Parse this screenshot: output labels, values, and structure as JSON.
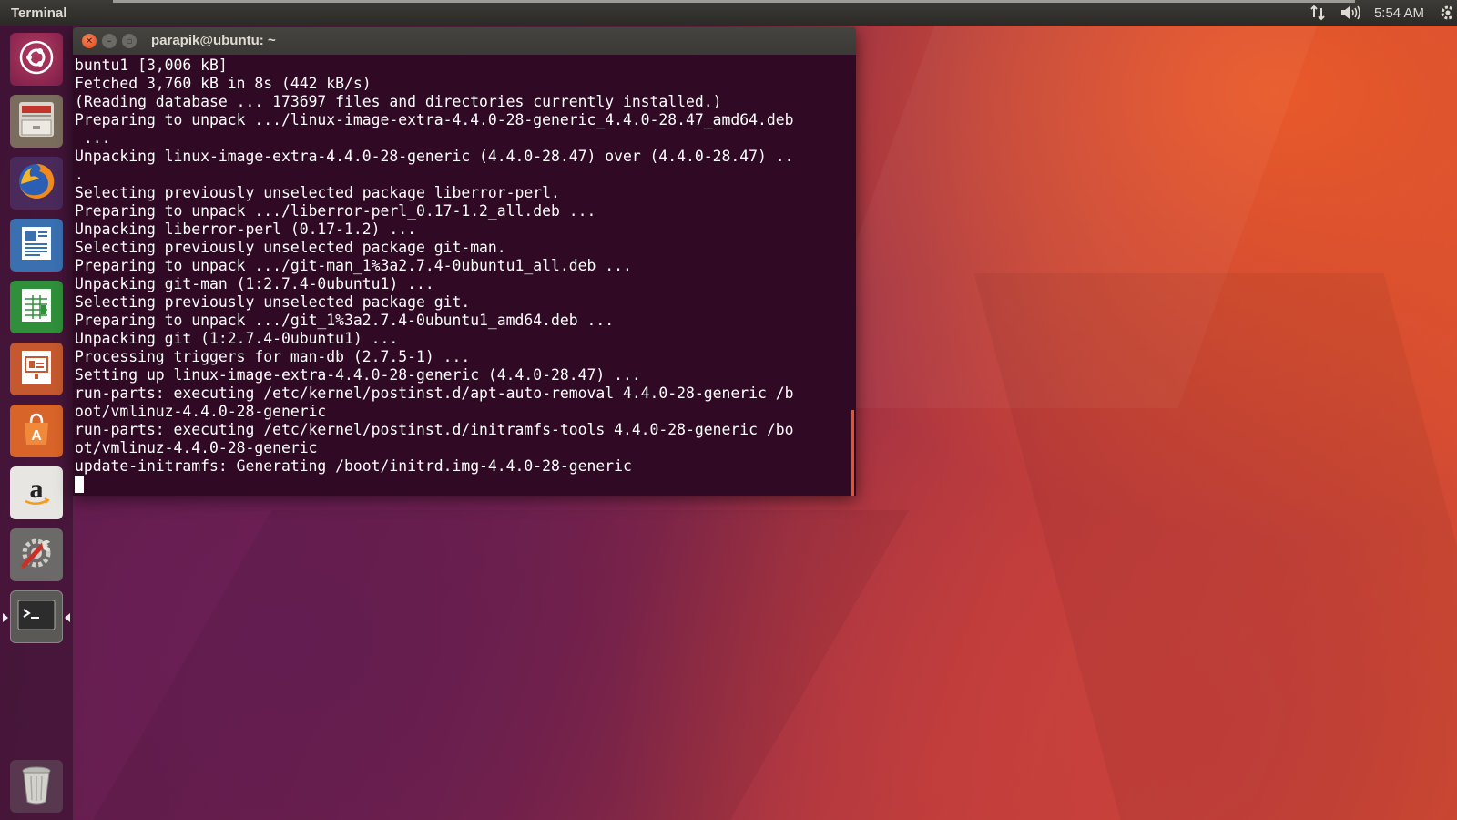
{
  "top_panel": {
    "app_title": "Terminal",
    "clock": "5:54 AM",
    "indicators": [
      {
        "name": "network-icon"
      },
      {
        "name": "volume-icon"
      },
      {
        "name": "settings-gear-icon"
      }
    ]
  },
  "launcher": {
    "items": [
      {
        "name": "dash-home",
        "icon": "ubuntu-logo-icon",
        "active": false
      },
      {
        "name": "files",
        "icon": "file-cabinet-icon",
        "active": false
      },
      {
        "name": "firefox",
        "icon": "firefox-icon",
        "active": false
      },
      {
        "name": "libreoffice-writer",
        "icon": "document-writer-icon",
        "active": false
      },
      {
        "name": "libreoffice-calc",
        "icon": "spreadsheet-calc-icon",
        "active": false
      },
      {
        "name": "libreoffice-impress",
        "icon": "presentation-impress-icon",
        "active": false
      },
      {
        "name": "software-center",
        "icon": "shopping-bag-icon",
        "active": false
      },
      {
        "name": "amazon",
        "icon": "amazon-icon",
        "active": false
      },
      {
        "name": "system-settings",
        "icon": "wrench-settings-icon",
        "active": false
      },
      {
        "name": "terminal",
        "icon": "terminal-icon",
        "active": true
      },
      {
        "name": "trash",
        "icon": "trash-icon",
        "active": false
      }
    ]
  },
  "terminal": {
    "title": "parapik@ubuntu: ~",
    "lines": [
      "buntu1 [3,006 kB]",
      "Fetched 3,760 kB in 8s (442 kB/s)",
      "(Reading database ... 173697 files and directories currently installed.)",
      "Preparing to unpack .../linux-image-extra-4.4.0-28-generic_4.4.0-28.47_amd64.deb",
      " ...",
      "Unpacking linux-image-extra-4.4.0-28-generic (4.4.0-28.47) over (4.4.0-28.47) ..",
      ".",
      "Selecting previously unselected package liberror-perl.",
      "Preparing to unpack .../liberror-perl_0.17-1.2_all.deb ...",
      "Unpacking liberror-perl (0.17-1.2) ...",
      "Selecting previously unselected package git-man.",
      "Preparing to unpack .../git-man_1%3a2.7.4-0ubuntu1_all.deb ...",
      "Unpacking git-man (1:2.7.4-0ubuntu1) ...",
      "Selecting previously unselected package git.",
      "Preparing to unpack .../git_1%3a2.7.4-0ubuntu1_amd64.deb ...",
      "Unpacking git (1:2.7.4-0ubuntu1) ...",
      "Processing triggers for man-db (2.7.5-1) ...",
      "Setting up linux-image-extra-4.4.0-28-generic (4.4.0-28.47) ...",
      "run-parts: executing /etc/kernel/postinst.d/apt-auto-removal 4.4.0-28-generic /b",
      "oot/vmlinuz-4.4.0-28-generic",
      "run-parts: executing /etc/kernel/postinst.d/initramfs-tools 4.4.0-28-generic /bo",
      "ot/vmlinuz-4.4.0-28-generic",
      "update-initramfs: Generating /boot/initrd.img-4.4.0-28-generic"
    ]
  },
  "colors": {
    "terminal_bg": "#300a24",
    "accent_orange": "#e95420",
    "panel_bg": "#3c3b37",
    "close_button": "#e0461a"
  }
}
